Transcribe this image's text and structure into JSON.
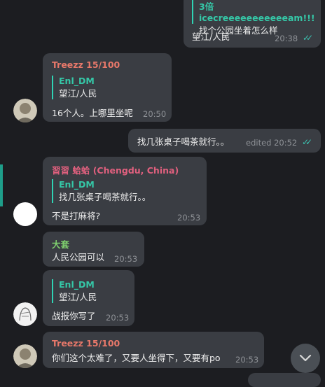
{
  "chat": {
    "messages": [
      {
        "direction": "out",
        "quote_name": "3倍 icecreeeeeeeeeeeam!!!",
        "quote_text": "找个公园坐着怎么样",
        "text": "望江/人民",
        "time": "20:38",
        "read": true
      },
      {
        "direction": "in",
        "sender": "Treezz 15/100",
        "sender_color": "#e8786a",
        "quote_name": "Enl_DM",
        "quote_text": "望江/人民",
        "text": "16个人。上哪里坐呢",
        "time": "20:50"
      },
      {
        "direction": "out",
        "text": "找几张桌子喝茶就行。。",
        "time": "edited 20:52",
        "read": true
      },
      {
        "direction": "in",
        "sender": "習習 蛤蛤 (Chengdu, China)",
        "sender_color": "#e0607e",
        "quote_name": "Enl_DM",
        "quote_text": "找几张桌子喝茶就行。。",
        "text": "不是打麻将?",
        "time": "20:53"
      },
      {
        "direction": "in",
        "sender": "大套",
        "sender_color": "#7fcf6e",
        "text": "人民公园可以",
        "time": "20:53"
      },
      {
        "direction": "in",
        "quote_name": "Enl_DM",
        "quote_text": "望江/人民",
        "text": "战报你写了",
        "time": "20:53"
      },
      {
        "direction": "in",
        "sender": "Treezz 15/100",
        "sender_color": "#e8786a",
        "text": "你们这个太难了，又要人坐得下，又要有po",
        "time": "20:53"
      }
    ]
  },
  "colors": {
    "accent": "#35c7a7",
    "background": "#1c1d21",
    "bubble": "#3a3d43"
  },
  "icons": {
    "read_ticks": "double-check-icon",
    "scroll_down": "chevron-down-icon"
  }
}
